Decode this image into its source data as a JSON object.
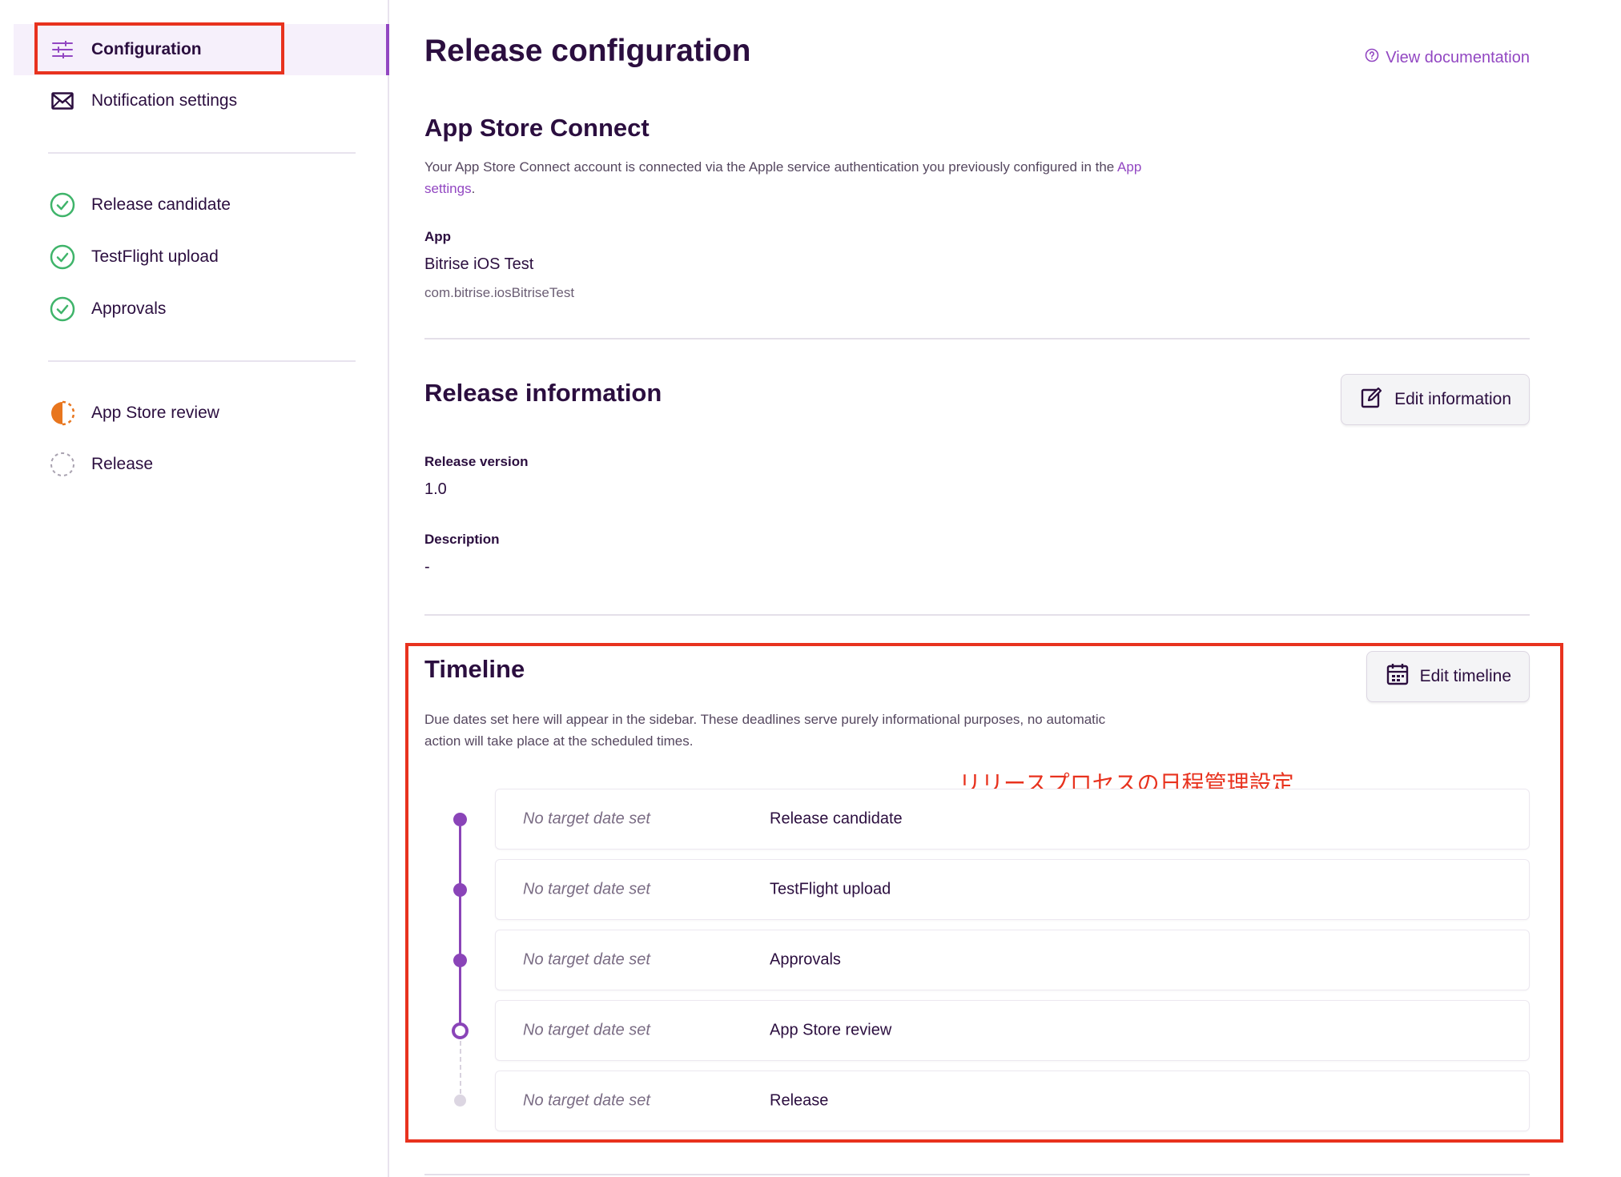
{
  "sidebar": {
    "items": [
      {
        "label": "Configuration",
        "icon": "sliders-icon",
        "active": true
      },
      {
        "label": "Notification settings",
        "icon": "envelope-icon"
      },
      {
        "label": "Release candidate",
        "icon": "check-circle-icon",
        "status": "done"
      },
      {
        "label": "TestFlight upload",
        "icon": "check-circle-icon",
        "status": "done"
      },
      {
        "label": "Approvals",
        "icon": "check-circle-icon",
        "status": "done"
      },
      {
        "label": "App Store review",
        "icon": "half-circle-icon",
        "status": "in-progress"
      },
      {
        "label": "Release",
        "icon": "dashed-circle-icon",
        "status": "pending"
      }
    ]
  },
  "header": {
    "title": "Release configuration",
    "doc_link": "View documentation"
  },
  "app_store_connect": {
    "title": "App Store Connect",
    "description_prefix": "Your App Store Connect account is connected via the Apple service authentication you previously configured in the ",
    "description_link": "App settings",
    "description_suffix": ".",
    "app_label": "App",
    "app_name": "Bitrise iOS Test",
    "bundle_id": "com.bitrise.iosBitriseTest"
  },
  "release_information": {
    "title": "Release information",
    "edit_button": "Edit information",
    "version_label": "Release version",
    "version_value": "1.0",
    "description_label": "Description",
    "description_value": "-"
  },
  "timeline": {
    "title": "Timeline",
    "edit_button": "Edit timeline",
    "description": "Due dates set here will appear in the sidebar. These deadlines serve purely informational purposes, no automatic action will take place at the scheduled times.",
    "rows": [
      {
        "date": "No target date set",
        "step": "Release candidate",
        "status": "done"
      },
      {
        "date": "No target date set",
        "step": "TestFlight upload",
        "status": "done"
      },
      {
        "date": "No target date set",
        "step": "Approvals",
        "status": "done"
      },
      {
        "date": "No target date set",
        "step": "App Store review",
        "status": "current"
      },
      {
        "date": "No target date set",
        "step": "Release",
        "status": "pending"
      }
    ]
  },
  "annotation": {
    "text": "リリースプロセスの日程管理設定",
    "color": "#e8321e"
  },
  "colors": {
    "accent": "#9247c2",
    "success": "#3fb46a",
    "warning": "#e8761e",
    "text": "#2b0e3f"
  }
}
